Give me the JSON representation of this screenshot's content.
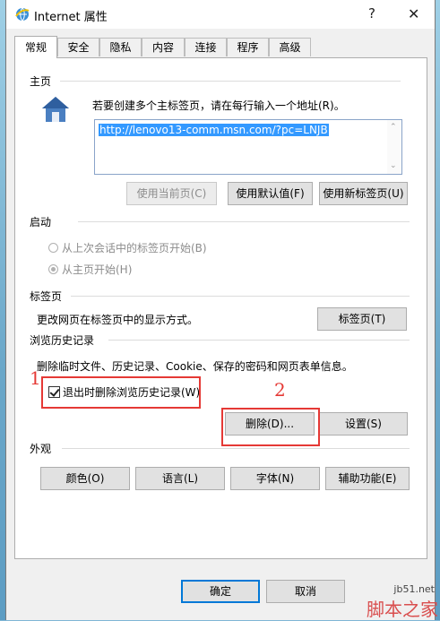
{
  "window": {
    "title": "Internet 属性",
    "help": "?",
    "close": "✕"
  },
  "tabs": [
    "常规",
    "安全",
    "隐私",
    "内容",
    "连接",
    "程序",
    "高级"
  ],
  "home": {
    "section": "主页",
    "desc": "若要创建多个主标签页，请在每行输入一个地址(R)。",
    "url": "http://lenovo13-comm.msn.com/?pc=LNJB",
    "buttons": {
      "current": "使用当前页(C)",
      "default": "使用默认值(F)",
      "newtab": "使用新标签页(U)"
    }
  },
  "startup": {
    "section": "启动",
    "option_last": "从上次会话中的标签页开始(B)",
    "option_home": "从主页开始(H)"
  },
  "tabs_section": {
    "section": "标签页",
    "desc": "更改网页在标签页中的显示方式。",
    "button": "标签页(T)"
  },
  "history": {
    "section": "浏览历史记录",
    "desc": "删除临时文件、历史记录、Cookie、保存的密码和网页表单信息。",
    "checkbox_label": "退出时删除浏览历史记录(W)",
    "delete_button": "删除(D)...",
    "settings_button": "设置(S)"
  },
  "appearance": {
    "section": "外观",
    "colors": "颜色(O)",
    "languages": "语言(L)",
    "fonts": "字体(N)",
    "accessibility": "辅助功能(E)"
  },
  "footer": {
    "ok": "确定",
    "cancel": "取消"
  },
  "annotations": {
    "one": "1",
    "two": "2"
  },
  "watermark": {
    "site": "jb51.net",
    "brand": "脚本之家"
  },
  "colors": {
    "accent": "#0078d7",
    "annotation": "#e53935",
    "selection": "#3399ff"
  }
}
